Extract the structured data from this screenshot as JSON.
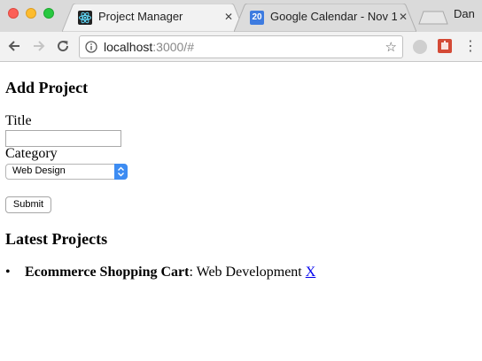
{
  "browser": {
    "tabs": [
      {
        "title": "Project Manager",
        "icon": "react-icon",
        "active": true
      },
      {
        "title": "Google Calendar - Nov 1",
        "icon": "calendar-icon",
        "icon_text": "20",
        "active": false
      }
    ],
    "profile_name": "Dan",
    "url_host": "localhost",
    "url_path": ":3000/#",
    "colors": {
      "tabstrip": "#dadada",
      "toolbar": "#f2f2f2",
      "select_accent": "#3d8cf2",
      "link": "#0000ee"
    }
  },
  "form": {
    "heading": "Add Project",
    "title_label": "Title",
    "title_value": "",
    "category_label": "Category",
    "category_selected": "Web Design",
    "submit_label": "Submit"
  },
  "projects": {
    "heading": "Latest Projects",
    "items": [
      {
        "bullet": "•",
        "title": "Ecommerce Shopping Cart",
        "separator": ":",
        "category": " Web Development ",
        "delete_label": "X"
      }
    ]
  }
}
